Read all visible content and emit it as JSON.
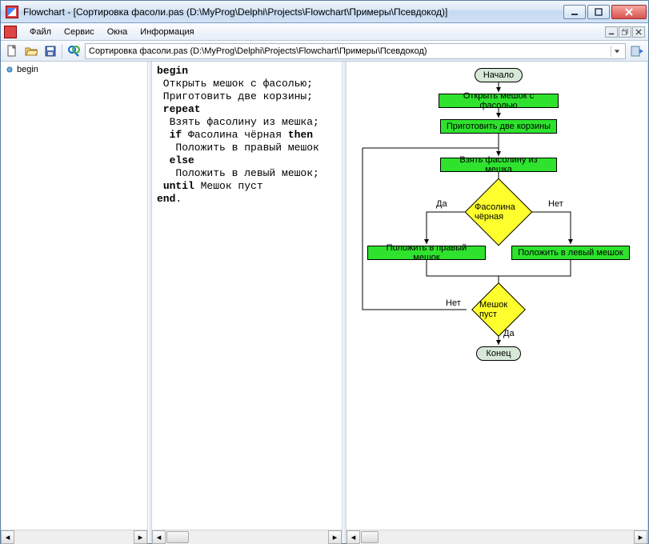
{
  "window": {
    "title": "Flowchart - [Сортировка фасоли.pas (D:\\MyProg\\Delphi\\Projects\\Flowchart\\Примеры\\Псевдокод)]"
  },
  "menu": {
    "file": "Файл",
    "service": "Сервис",
    "windows": "Окна",
    "info": "Информация"
  },
  "toolbar": {
    "address": "Сортировка фасоли.pas (D:\\MyProg\\Delphi\\Projects\\Flowchart\\Примеры\\Псевдокод)"
  },
  "tree": {
    "root": "begin"
  },
  "code": {
    "l1_kw": "begin",
    "l2": " Открыть мешок с фасолью;",
    "l3": " Приготовить две корзины;",
    "l4_kw": " repeat",
    "l5": "  Взять фасолину из мешка;",
    "l6a": "  ",
    "l6kw1": "if",
    "l6b": " Фасолина чёрная ",
    "l6kw2": "then",
    "l7": "   Положить в правый мешок",
    "l8_kw": "  else",
    "l9": "   Положить в левый мешок;",
    "l10a": " ",
    "l10kw": "until",
    "l10b": " Мешок пуст",
    "l11_kw": "end",
    "l11b": "."
  },
  "flow": {
    "start": "Начало",
    "open": "Открыть мешок с фасолью",
    "prep": "Приготовить две корзины",
    "take": "Взять фасолину из мешка",
    "cond1": "Фасолина чёрная",
    "yes": "Да",
    "no": "Нет",
    "right": "Положить в правый мешок",
    "left": "Положить в левый мешок",
    "cond2": "Мешок пуст",
    "end": "Конец"
  }
}
